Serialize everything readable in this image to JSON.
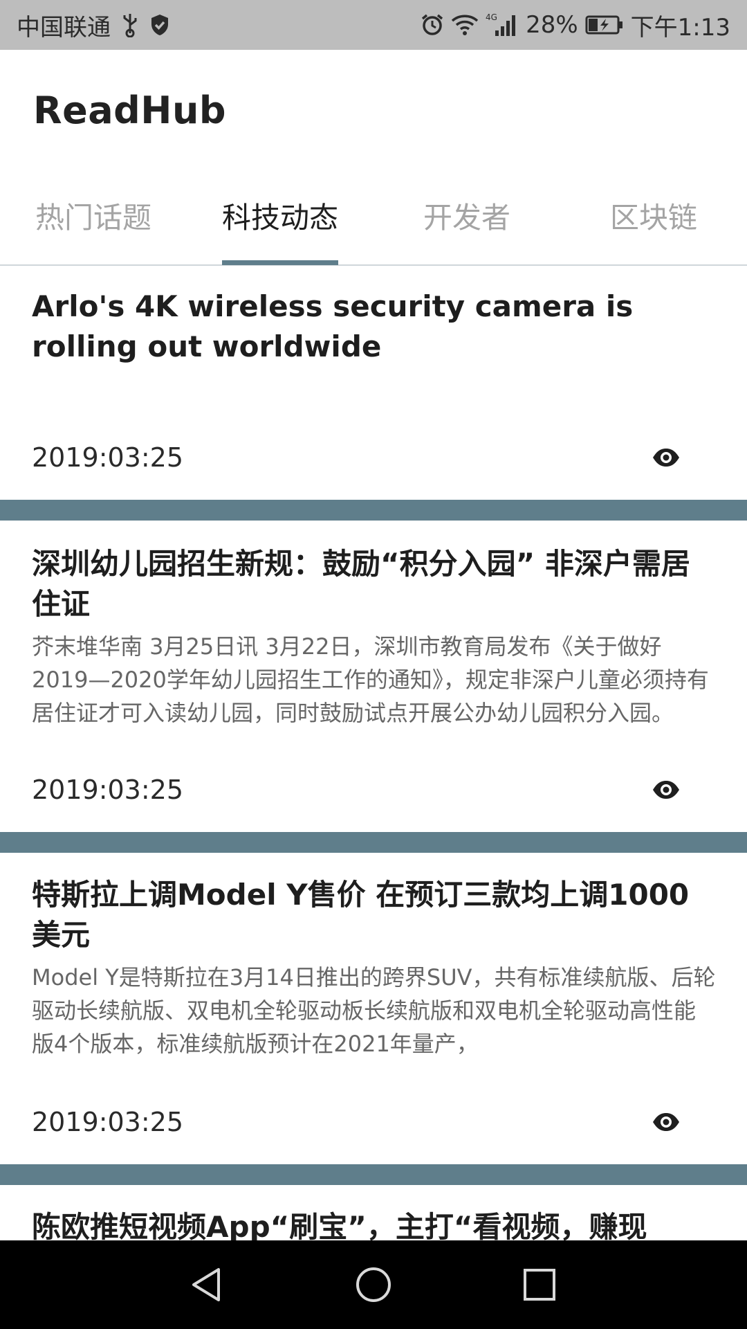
{
  "status_bar": {
    "carrier": "中国联通",
    "network": "4G",
    "battery": "28%",
    "time": "下午1:13",
    "icons": [
      "usb-icon",
      "shield-icon",
      "alarm-icon",
      "wifi-icon",
      "signal-icon",
      "battery-icon"
    ]
  },
  "app_bar": {
    "title": "ReadHub"
  },
  "tabs": [
    {
      "label": "热门话题",
      "active": false
    },
    {
      "label": "科技动态",
      "active": true
    },
    {
      "label": "开发者",
      "active": false
    },
    {
      "label": "区块链",
      "active": false
    }
  ],
  "colors": {
    "accent": "#5f7e8b",
    "status_bar_bg": "#bdbdbd",
    "inactive_tab": "#a4a4a4",
    "summary_text": "#666666"
  },
  "feed": {
    "items": [
      {
        "title": "Arlo's 4K wireless security camera is rolling out worldwide",
        "summary": "",
        "date": "2019:03:25",
        "icon": "eye-icon"
      },
      {
        "title": "深圳幼儿园招生新规：鼓励“积分入园” 非深户需居住证",
        "summary": "芥末堆华南 3月25日讯 3月22日，深圳市教育局发布《关于做好2019—2020学年幼儿园招生工作的通知》，规定非深户儿童必须持有居住证才可入读幼儿园，同时鼓励试点开展公办幼儿园积分入园。",
        "date": "2019:03:25",
        "icon": "eye-icon"
      },
      {
        "title": "特斯拉上调Model Y售价 在预订三款均上调1000美元",
        "summary": "Model Y是特斯拉在3月14日推出的跨界SUV，共有标准续航版、后轮驱动长续航版、双电机全轮驱动板长续航版和双电机全轮驱动高性能版4个版本，标准续航版预计在2021年量产，",
        "date": "2019:03:25",
        "icon": "eye-icon"
      },
      {
        "title": "陈欧推短视频App“刷宝”，主打“看视频，赚现",
        "summary": "",
        "date": "",
        "icon": "eye-icon"
      }
    ]
  },
  "nav_bar": {
    "buttons": [
      "back-icon",
      "home-icon",
      "recents-icon"
    ]
  }
}
